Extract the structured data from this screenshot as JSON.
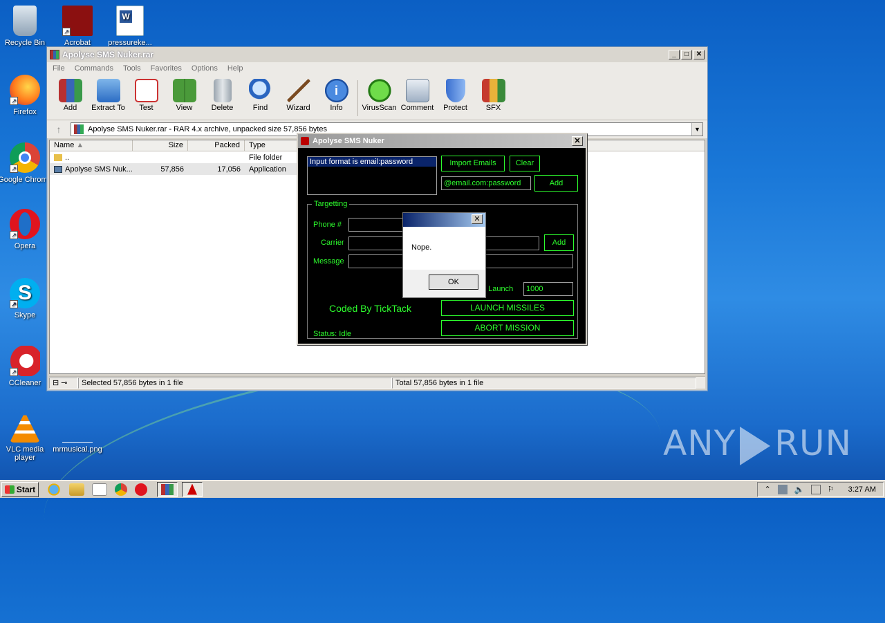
{
  "desktop": {
    "icons": [
      {
        "label": "Recycle Bin"
      },
      {
        "label": "Acrobat"
      },
      {
        "label": "pressureke..."
      },
      {
        "label": "Firefox"
      },
      {
        "label": "Google Chrome"
      },
      {
        "label": "Opera"
      },
      {
        "label": "Skype"
      },
      {
        "label": "CCleaner"
      },
      {
        "label": "VLC media player"
      },
      {
        "label": "mrmusical.png"
      }
    ],
    "watermark": "ANY RUN"
  },
  "winrar": {
    "title": "Apolyse SMS Nuker.rar",
    "menu": [
      "File",
      "Commands",
      "Tools",
      "Favorites",
      "Options",
      "Help"
    ],
    "toolbar": [
      "Add",
      "Extract To",
      "Test",
      "View",
      "Delete",
      "Find",
      "Wizard",
      "Info",
      "VirusScan",
      "Comment",
      "Protect",
      "SFX"
    ],
    "address": "Apolyse SMS Nuker.rar - RAR 4.x archive, unpacked size 57,856 bytes",
    "columns": [
      "Name",
      "Size",
      "Packed",
      "Type"
    ],
    "rows": [
      {
        "name": "..",
        "size": "",
        "packed": "",
        "type": "File folder"
      },
      {
        "name": "Apolyse SMS Nuk...",
        "size": "57,856",
        "packed": "17,056",
        "type": "Application"
      }
    ],
    "status_left": "Selected 57,856 bytes in 1 file",
    "status_right": "Total 57,856 bytes in 1 file"
  },
  "nuker": {
    "title": "Apolyse SMS Nuker",
    "list_item": "Input format is email:password",
    "import_button": "Import Emails",
    "clear_button": "Clear",
    "email_value": "@email.com:password",
    "add_email_button": "Add",
    "targetting_label": "Targetting",
    "phone_label": "Phone #",
    "carrier_label": "Carrier",
    "carrier_add_button": "Add",
    "message_label": "Message",
    "launch_count_label": "o Launch",
    "launch_count_value": "1000",
    "launch_button": "LAUNCH MISSILES",
    "abort_button": "ABORT MISSION",
    "credit": "Coded By TickTack",
    "status": "Status: Idle"
  },
  "msgbox": {
    "message": "Nope.",
    "ok_button": "OK"
  },
  "taskbar": {
    "start_label": "Start",
    "clock": "3:27 AM"
  }
}
